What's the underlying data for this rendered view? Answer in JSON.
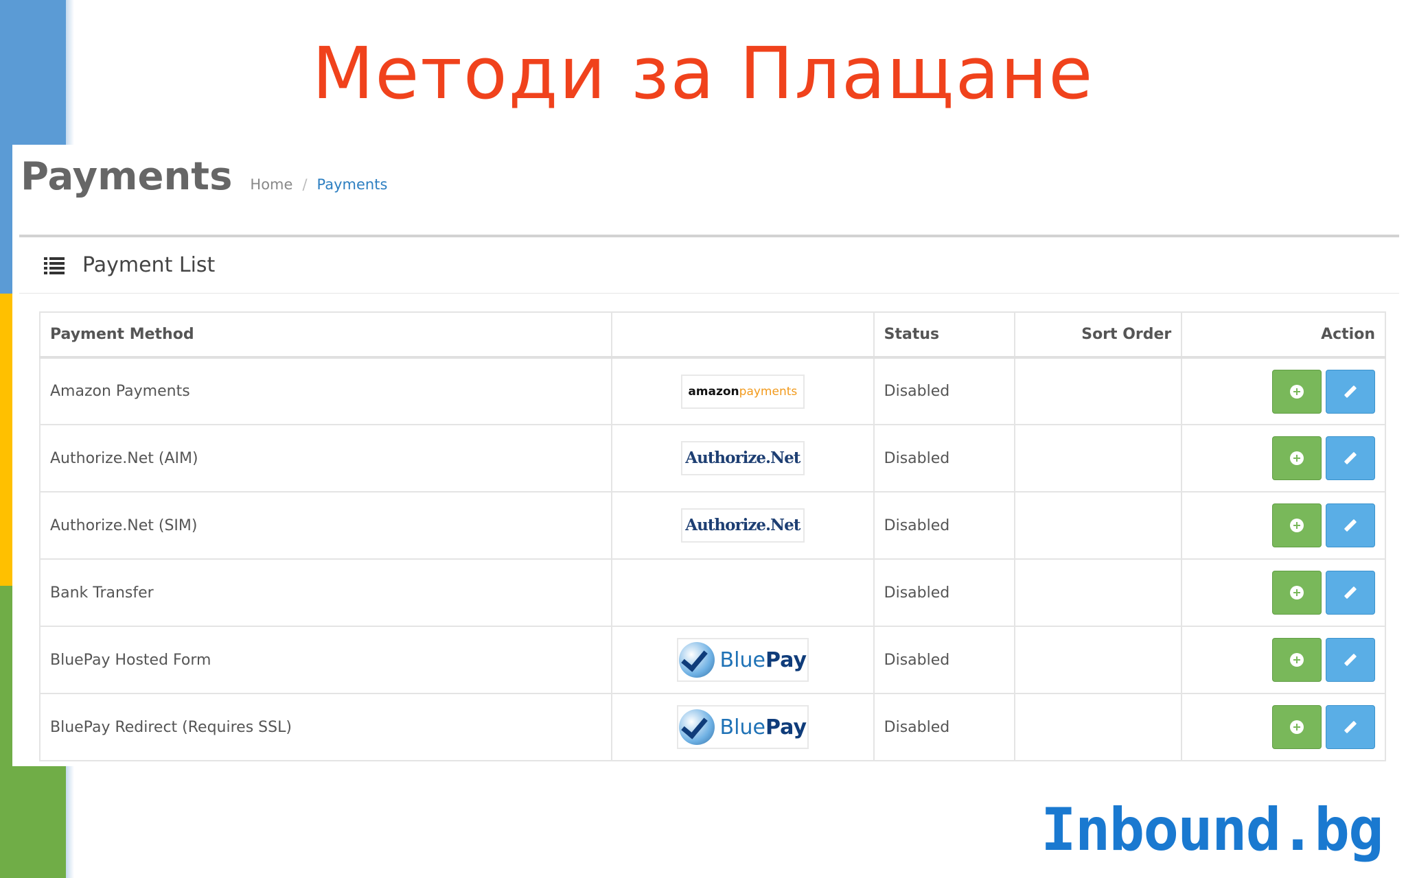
{
  "slide": {
    "title": "Методи за Плащане",
    "brand": "Inbound.bg"
  },
  "header": {
    "title": "Payments",
    "breadcrumb": {
      "home": "Home",
      "separator": "/",
      "current": "Payments"
    }
  },
  "card": {
    "title": "Payment List",
    "icon": "list-icon"
  },
  "table": {
    "columns": {
      "method": "Payment Method",
      "logo": "",
      "status": "Status",
      "sort": "Sort Order",
      "action": "Action"
    },
    "rows": [
      {
        "method": "Amazon Payments",
        "logo": "amazon",
        "logo_text_1": "amazon",
        "logo_text_2": "payments",
        "status": "Disabled",
        "sort": ""
      },
      {
        "method": "Authorize.Net (AIM)",
        "logo": "authorize-net",
        "logo_text": "Authorize.Net",
        "status": "Disabled",
        "sort": ""
      },
      {
        "method": "Authorize.Net (SIM)",
        "logo": "authorize-net",
        "logo_text": "Authorize.Net",
        "status": "Disabled",
        "sort": ""
      },
      {
        "method": "Bank Transfer",
        "logo": "",
        "status": "Disabled",
        "sort": ""
      },
      {
        "method": "BluePay Hosted Form",
        "logo": "bluepay",
        "logo_text_1": "Blue",
        "logo_text_2": "Pay",
        "status": "Disabled",
        "sort": ""
      },
      {
        "method": "BluePay Redirect (Requires SSL)",
        "logo": "bluepay",
        "logo_text_1": "Blue",
        "logo_text_2": "Pay",
        "status": "Disabled",
        "sort": ""
      }
    ]
  },
  "colors": {
    "title_red": "#f0421c",
    "install_green": "#79b85a",
    "edit_blue": "#5aaee6",
    "strip_blue": "#5b9bd5",
    "strip_yellow": "#ffc000",
    "strip_green": "#70ad47"
  }
}
